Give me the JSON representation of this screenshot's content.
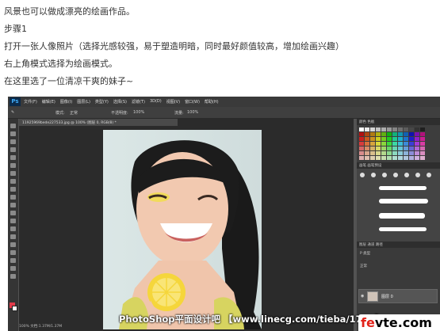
{
  "article": {
    "lines": [
      "风景也可以做成漂亮的绘画作品。",
      "步骤1",
      "打开一张人像照片（选择光感较强，易于塑造明暗，同时最好颜值较高，增加绘画兴趣）",
      "右上角模式选择为绘画模式。",
      "在这里选了一位清凉干爽的妹子~"
    ]
  },
  "ps": {
    "logo": "Ps",
    "menus": [
      "文件(F)",
      "编辑(E)",
      "图像(I)",
      "图层(L)",
      "类型(Y)",
      "选择(S)",
      "滤镜(T)",
      "3D(D)",
      "视图(V)",
      "窗口(W)",
      "帮助(H)"
    ],
    "options": {
      "mode_label": "模式:",
      "mode_value": "正常",
      "opacity_label": "不透明度:",
      "opacity_value": "100%",
      "flow_label": "流量:",
      "flow_value": "100%"
    },
    "doc_tab": "11925969bede227533.jpg @ 100% (图层 0, RGB/8) *",
    "status": "100%   文档:1.37M/1.37M",
    "panels": {
      "swatches": "颜色  色板",
      "brushes": "画笔  画笔预设",
      "layers": "图层  通道  路径",
      "layer_kind": "P 类型",
      "blend": "正常",
      "layer_name": "图层 0"
    }
  },
  "watermark": "PhotoShop平面设计吧 【www.linecg.com/tieba/1783】",
  "site": {
    "part1": "fe",
    "part2": "vte.com"
  },
  "colors": {
    "ps_bg": "#535353",
    "panel_bg": "#3d3d3d",
    "skin": "#f2c9b0",
    "hair": "#1a1a1a",
    "lemon": "#f5d63b",
    "shirt": "#d7d460",
    "site_red": "#e2231a"
  }
}
